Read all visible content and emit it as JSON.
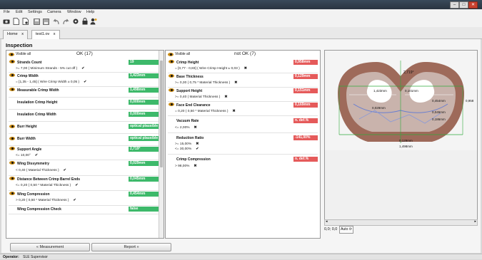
{
  "menu": [
    "File",
    "Edit",
    "Settings",
    "Camera",
    "Window",
    "Help"
  ],
  "window_controls": {
    "minimize": "–",
    "maximize": "□",
    "close": "✕"
  },
  "tabs": [
    {
      "label": "Home",
      "close": "x"
    },
    {
      "label": "test1.ov",
      "close": "x"
    }
  ],
  "inspection": {
    "title": "Inspection"
  },
  "ok_panel": {
    "header": "OK (17)",
    "visible_all": "Visible all",
    "rows": [
      {
        "name": "Strands Count",
        "value": "19",
        "sub": ">= 7,00 ( Minimum Strands - 5% cut off )",
        "mark": "✔"
      },
      {
        "name": "Crimp Width",
        "value": "1,423mm",
        "sub": "= [1,35 - 1,45] ( Wire Crimp Width ± 0,05 )",
        "mark": "✔"
      },
      {
        "name": "Measurable Crimp Width",
        "value": "1,498mm",
        "sub": "",
        "mark": ""
      },
      {
        "name": "Insulation Crimp Height",
        "value": "0,000mm",
        "sub": "",
        "mark": ""
      },
      {
        "name": "Insulation Crimp Width",
        "value": "0,000mm",
        "sub": "",
        "mark": ""
      },
      {
        "name": "Burr Height",
        "value": "optical plausible",
        "sub": "",
        "mark": ""
      },
      {
        "name": "Burr Width",
        "value": "optical plausible",
        "sub": "",
        "mark": ""
      },
      {
        "name": "Support Angle",
        "value": "2,719°",
        "sub": "<= 10,00°",
        "mark": "✔"
      },
      {
        "name": "Wing Dissymmetry",
        "value": "0,029mm",
        "sub": "< 0,40 ( Material Thickness )",
        "mark": "✔"
      },
      {
        "name": "Distance Between Crimp Barrel Ends",
        "value": "0,045mm",
        "sub": "<= 0,20 ( 0,50 * Material Thickness )",
        "mark": "✔"
      },
      {
        "name": "Wing Compression",
        "value": "0,454mm",
        "sub": "> 0,20 ( 0,50 * Material Thickness )",
        "mark": "✔"
      },
      {
        "name": "Wing Compression Check",
        "value": "false",
        "sub": "",
        "mark": ""
      }
    ]
  },
  "nok_panel": {
    "header": "not OK (7)",
    "visible_all": "Visible all",
    "rows": [
      {
        "name": "Crimp Height",
        "value": "0,958mm",
        "sub": "= [0,77 - 0,83] ( Wire Crimp Height ± 0,03 )",
        "mark": "✖"
      },
      {
        "name": "Base Thickness",
        "value": "0,129mm",
        "sub": ">= 0,30 ( 0,75 * Material Thickness )",
        "mark": "✖"
      },
      {
        "name": "Support Height",
        "value": "0,151mm",
        "sub": ">= 0,40 ( Material Thickness )",
        "mark": "✖"
      },
      {
        "name": "Face End Clearance",
        "value": "0,169mm",
        "sub": "= 0,20 ( 0,50 * Material Thickness )",
        "mark": "✖"
      },
      {
        "name": "Vacuum Rate",
        "value": "n. def.%",
        "sub": "<= 2,00%",
        "mark": "✖"
      },
      {
        "name": "Reduction Ratio",
        "value": "-141,00%",
        "sub": ">= 15,00%",
        "mark": "✖",
        "sub2": "<= 30,00%",
        "mark2": "✔"
      },
      {
        "name": "Crimp Compression",
        "value": "n. def.%",
        "sub": "> 98,00%",
        "mark": "✖"
      }
    ]
  },
  "buttons": {
    "measurement": "« Measurement",
    "report": "Report »"
  },
  "image_labels": [
    "2,719°",
    "1,423mm",
    "0,101mm",
    "0,454mm",
    "0,045mm",
    "0,958",
    "0,186mm",
    "0,029mm",
    "0,129mm",
    "1,498mm"
  ],
  "coords": "0,0; 0,0",
  "auto_label": "Auto ⟳",
  "status": {
    "label": "Operator:",
    "value": "SLE Supervisor"
  }
}
